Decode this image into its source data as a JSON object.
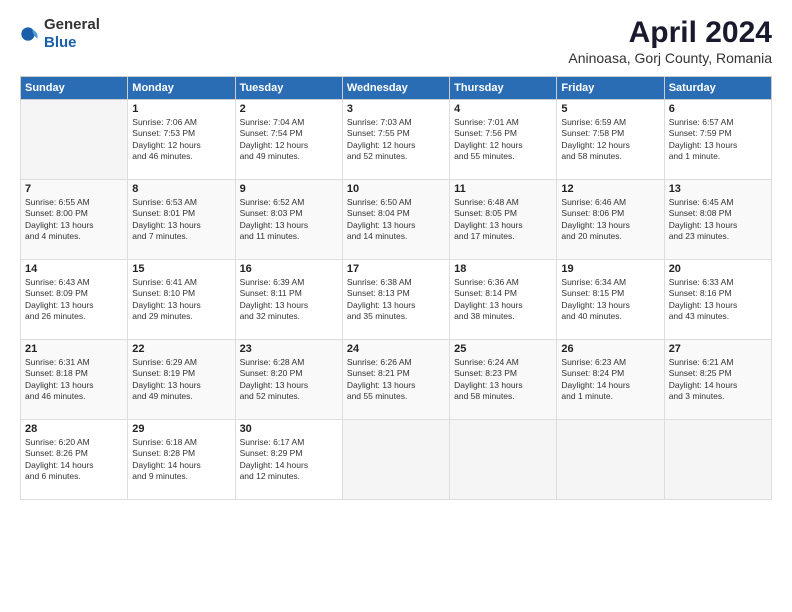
{
  "header": {
    "logo_general": "General",
    "logo_blue": "Blue",
    "main_title": "April 2024",
    "subtitle": "Aninoasa, Gorj County, Romania"
  },
  "days_of_week": [
    "Sunday",
    "Monday",
    "Tuesday",
    "Wednesday",
    "Thursday",
    "Friday",
    "Saturday"
  ],
  "weeks": [
    [
      {
        "day": "",
        "info": ""
      },
      {
        "day": "1",
        "info": "Sunrise: 7:06 AM\nSunset: 7:53 PM\nDaylight: 12 hours\nand 46 minutes."
      },
      {
        "day": "2",
        "info": "Sunrise: 7:04 AM\nSunset: 7:54 PM\nDaylight: 12 hours\nand 49 minutes."
      },
      {
        "day": "3",
        "info": "Sunrise: 7:03 AM\nSunset: 7:55 PM\nDaylight: 12 hours\nand 52 minutes."
      },
      {
        "day": "4",
        "info": "Sunrise: 7:01 AM\nSunset: 7:56 PM\nDaylight: 12 hours\nand 55 minutes."
      },
      {
        "day": "5",
        "info": "Sunrise: 6:59 AM\nSunset: 7:58 PM\nDaylight: 12 hours\nand 58 minutes."
      },
      {
        "day": "6",
        "info": "Sunrise: 6:57 AM\nSunset: 7:59 PM\nDaylight: 13 hours\nand 1 minute."
      }
    ],
    [
      {
        "day": "7",
        "info": "Sunrise: 6:55 AM\nSunset: 8:00 PM\nDaylight: 13 hours\nand 4 minutes."
      },
      {
        "day": "8",
        "info": "Sunrise: 6:53 AM\nSunset: 8:01 PM\nDaylight: 13 hours\nand 7 minutes."
      },
      {
        "day": "9",
        "info": "Sunrise: 6:52 AM\nSunset: 8:03 PM\nDaylight: 13 hours\nand 11 minutes."
      },
      {
        "day": "10",
        "info": "Sunrise: 6:50 AM\nSunset: 8:04 PM\nDaylight: 13 hours\nand 14 minutes."
      },
      {
        "day": "11",
        "info": "Sunrise: 6:48 AM\nSunset: 8:05 PM\nDaylight: 13 hours\nand 17 minutes."
      },
      {
        "day": "12",
        "info": "Sunrise: 6:46 AM\nSunset: 8:06 PM\nDaylight: 13 hours\nand 20 minutes."
      },
      {
        "day": "13",
        "info": "Sunrise: 6:45 AM\nSunset: 8:08 PM\nDaylight: 13 hours\nand 23 minutes."
      }
    ],
    [
      {
        "day": "14",
        "info": "Sunrise: 6:43 AM\nSunset: 8:09 PM\nDaylight: 13 hours\nand 26 minutes."
      },
      {
        "day": "15",
        "info": "Sunrise: 6:41 AM\nSunset: 8:10 PM\nDaylight: 13 hours\nand 29 minutes."
      },
      {
        "day": "16",
        "info": "Sunrise: 6:39 AM\nSunset: 8:11 PM\nDaylight: 13 hours\nand 32 minutes."
      },
      {
        "day": "17",
        "info": "Sunrise: 6:38 AM\nSunset: 8:13 PM\nDaylight: 13 hours\nand 35 minutes."
      },
      {
        "day": "18",
        "info": "Sunrise: 6:36 AM\nSunset: 8:14 PM\nDaylight: 13 hours\nand 38 minutes."
      },
      {
        "day": "19",
        "info": "Sunrise: 6:34 AM\nSunset: 8:15 PM\nDaylight: 13 hours\nand 40 minutes."
      },
      {
        "day": "20",
        "info": "Sunrise: 6:33 AM\nSunset: 8:16 PM\nDaylight: 13 hours\nand 43 minutes."
      }
    ],
    [
      {
        "day": "21",
        "info": "Sunrise: 6:31 AM\nSunset: 8:18 PM\nDaylight: 13 hours\nand 46 minutes."
      },
      {
        "day": "22",
        "info": "Sunrise: 6:29 AM\nSunset: 8:19 PM\nDaylight: 13 hours\nand 49 minutes."
      },
      {
        "day": "23",
        "info": "Sunrise: 6:28 AM\nSunset: 8:20 PM\nDaylight: 13 hours\nand 52 minutes."
      },
      {
        "day": "24",
        "info": "Sunrise: 6:26 AM\nSunset: 8:21 PM\nDaylight: 13 hours\nand 55 minutes."
      },
      {
        "day": "25",
        "info": "Sunrise: 6:24 AM\nSunset: 8:23 PM\nDaylight: 13 hours\nand 58 minutes."
      },
      {
        "day": "26",
        "info": "Sunrise: 6:23 AM\nSunset: 8:24 PM\nDaylight: 14 hours\nand 1 minute."
      },
      {
        "day": "27",
        "info": "Sunrise: 6:21 AM\nSunset: 8:25 PM\nDaylight: 14 hours\nand 3 minutes."
      }
    ],
    [
      {
        "day": "28",
        "info": "Sunrise: 6:20 AM\nSunset: 8:26 PM\nDaylight: 14 hours\nand 6 minutes."
      },
      {
        "day": "29",
        "info": "Sunrise: 6:18 AM\nSunset: 8:28 PM\nDaylight: 14 hours\nand 9 minutes."
      },
      {
        "day": "30",
        "info": "Sunrise: 6:17 AM\nSunset: 8:29 PM\nDaylight: 14 hours\nand 12 minutes."
      },
      {
        "day": "",
        "info": ""
      },
      {
        "day": "",
        "info": ""
      },
      {
        "day": "",
        "info": ""
      },
      {
        "day": "",
        "info": ""
      }
    ]
  ]
}
